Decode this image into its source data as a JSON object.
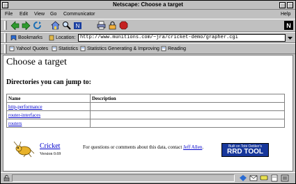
{
  "window": {
    "title": "Netscape: Choose a target"
  },
  "menu": {
    "items": [
      "File",
      "Edit",
      "View",
      "Go",
      "Communicator"
    ],
    "help": "Help"
  },
  "location": {
    "bookmarks_label": "Bookmarks",
    "location_label": "Location:",
    "url": "http://www.munitions.com/~jra/cricket-demo/grapher.cgi"
  },
  "personal_toolbar": {
    "items": [
      "Yahoo! Quotes",
      "Statistics",
      "Statistics Generating & Improving",
      "Reading"
    ]
  },
  "page": {
    "heading": "Choose a target",
    "subheading": "Directories you can jump to:",
    "table": {
      "headers": [
        "Name",
        "Description"
      ],
      "rows": [
        {
          "name": "http-performance",
          "description": ""
        },
        {
          "name": "router-interfaces",
          "description": ""
        },
        {
          "name": "routers",
          "description": ""
        }
      ]
    },
    "footer": {
      "cricket_link": "Cricket",
      "version": "Version 0.69",
      "contact_text": "For questions or comments about this data, contact ",
      "contact_link": "Jeff Allen",
      "contact_end": ".",
      "rrd_small": "Built on Tobi Oetiker's",
      "rrd_big": "RRD TOOL"
    }
  },
  "icons": {
    "back": "back-arrow-icon",
    "forward": "forward-arrow-icon",
    "reload": "reload-icon",
    "home": "home-icon",
    "search": "search-icon",
    "netscape": "netscape-icon",
    "print": "print-icon",
    "security": "security-icon",
    "stop": "stop-icon",
    "logo": "netscape-n-logo-icon"
  },
  "colors": {
    "link": "#0000cc",
    "chrome": "#c0c0c0",
    "rrd": "#17379b"
  }
}
